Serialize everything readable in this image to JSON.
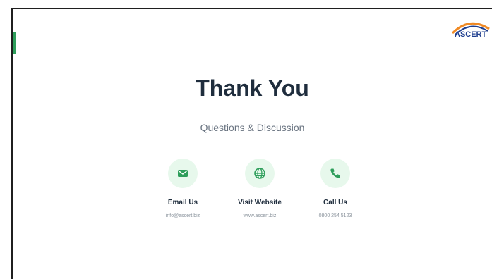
{
  "logo": {
    "text": "ASCERT",
    "arc_colors": [
      "#f08a24",
      "#1f3f8f"
    ]
  },
  "slide": {
    "title": "Thank You",
    "subtitle": "Questions & Discussion"
  },
  "contacts": [
    {
      "icon": "envelope-icon",
      "label": "Email Us",
      "value": "info@ascert.biz"
    },
    {
      "icon": "globe-icon",
      "label": "Visit Website",
      "value": "www.ascert.biz"
    },
    {
      "icon": "phone-icon",
      "label": "Call Us",
      "value": "0800 254 5123"
    }
  ],
  "colors": {
    "accent": "#2e9e5b",
    "icon_bg": "#e7f8ec",
    "title": "#1f2d3d",
    "muted": "#8a939c"
  }
}
